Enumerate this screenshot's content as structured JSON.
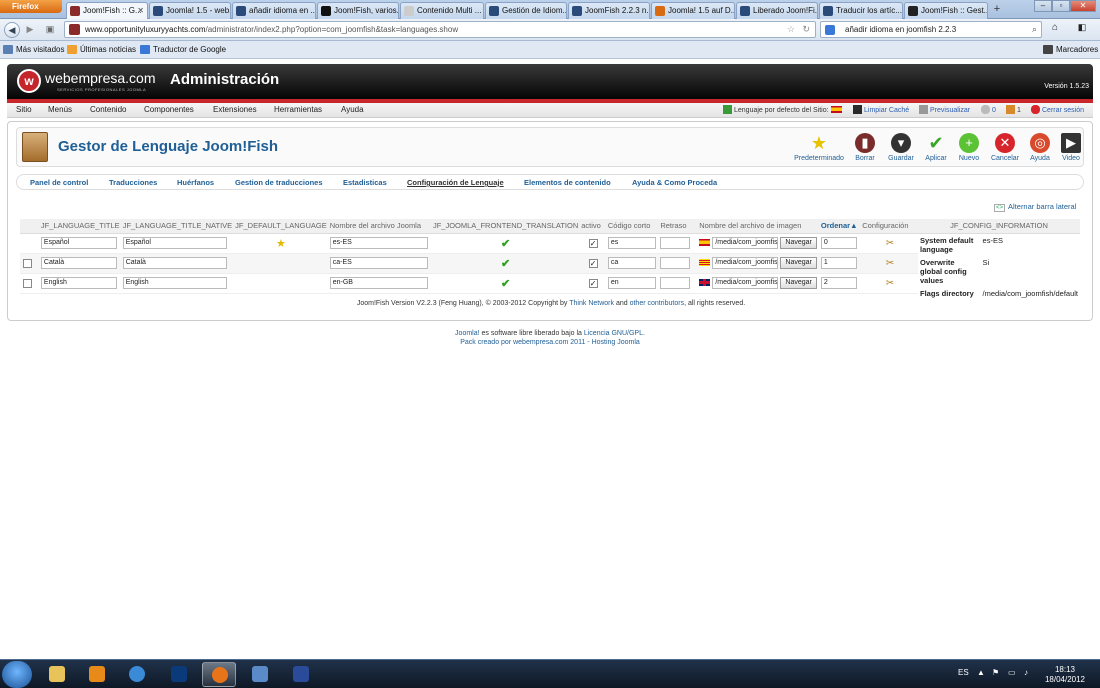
{
  "browser": {
    "app_button": "Firefox",
    "tabs": [
      {
        "label": "Joom!Fish :: G..."
      },
      {
        "label": "Joomla! 1.5 - web..."
      },
      {
        "label": "añadir idioma en ..."
      },
      {
        "label": "Joom!Fish, varios..."
      },
      {
        "label": "Contenido Multi ..."
      },
      {
        "label": "Gestión de Idiom..."
      },
      {
        "label": "JoomFish 2.2.3 n..."
      },
      {
        "label": "Joomla! 1.5 auf D..."
      },
      {
        "label": "Liberado Joom!Fi..."
      },
      {
        "label": "Traducir los artíc..."
      },
      {
        "label": "Joom!Fish :: Gest..."
      }
    ],
    "new_tab": "+",
    "url_host": "www.opportunityluxuryyachts.com",
    "url_path": "/administrator/index2.php?option=com_joomfish&task=languages.show",
    "search_value": "añadir idioma en joomfish 2.2.3",
    "bookmarks": [
      "Más visitados",
      "Últimas noticias",
      "Traductor de Google"
    ],
    "bookmarks_menu": "Marcadores"
  },
  "header": {
    "brand": "webempresa.com",
    "brand_sub": "SERVICIOS PROFESIONALES JOOMLA",
    "title": "Administración",
    "version": "Versión 1.5.23"
  },
  "menu": {
    "items": [
      "Sitio",
      "Menús",
      "Contenido",
      "Componentes",
      "Extensiones",
      "Herramientas",
      "Ayuda"
    ],
    "default_lang": "Lenguaje por defecto del Sitio:",
    "clear_cache": "Limpiar Caché",
    "preview": "Previsualizar",
    "messages": "0",
    "users": "1",
    "logout": "Cerrar sesión"
  },
  "toolbar": {
    "title": "Gestor de Lenguaje Joom!Fish",
    "buttons": [
      {
        "label": "Predeterminado",
        "icon": "star-icon",
        "color": "#e6c200"
      },
      {
        "label": "Borrar",
        "icon": "trash-icon",
        "color": "#7a2b2b"
      },
      {
        "label": "Guardar",
        "icon": "save-icon",
        "color": "#333333"
      },
      {
        "label": "Aplicar",
        "icon": "check-icon",
        "color": "#3aa52a"
      },
      {
        "label": "Nuevo",
        "icon": "plus-icon",
        "color": "#5bc236"
      },
      {
        "label": "Cancelar",
        "icon": "cancel-icon",
        "color": "#d6262c"
      },
      {
        "label": "Ayuda",
        "icon": "help-icon",
        "color": "#d94a2c"
      },
      {
        "label": "Video",
        "icon": "video-icon",
        "color": "#333333"
      }
    ]
  },
  "subnav": [
    "Panel de control",
    "Traducciones",
    "Huérfanos",
    "Gestion de traducciones",
    "Estadisticas",
    "Configuración de Lenguaje",
    "Elementos de contenido",
    "Ayuda & Como Proceda"
  ],
  "toggle_label": "Alternar barra lateral",
  "toggle_icon_text": "<>",
  "table": {
    "headers": [
      "JF_LANGUAGE_TITLE",
      "JF_LANGUAGE_TITLE_NATIVE",
      "JF_DEFAULT_LANGUAGE",
      "Nombre del archivo Joomla",
      "JF_JOOMLA_FRONTEND_TRANSLATION",
      "activo",
      "Código corto",
      "Retraso",
      "Nombre del archivo de imagen",
      "Ordenar",
      "Configuración"
    ],
    "rows": [
      {
        "title": "Español",
        "native": "Español",
        "file": "es-ES",
        "code": "es",
        "image": "/media/com_joomfish/...",
        "order": "0"
      },
      {
        "title": "Català",
        "native": "Català",
        "file": "ca-ES",
        "code": "ca",
        "image": "/media/com_joomfish/...",
        "order": "1"
      },
      {
        "title": "English",
        "native": "English",
        "file": "en-GB",
        "code": "en",
        "image": "/media/com_joomfish/...",
        "order": "2"
      }
    ],
    "browse_label": "Navegar"
  },
  "config": {
    "header": "JF_CONFIG_INFORMATION",
    "rows": [
      {
        "key": "System default language",
        "value": "es-ES"
      },
      {
        "key": "Overwrite global config values",
        "value": "Si"
      },
      {
        "key": "Flags directory",
        "value": "/media/com_joomfish/default"
      }
    ]
  },
  "copyright": {
    "pre": "Joom!Fish Version V2.2.3 (Feng Huang), © 2003-2012 Copyright by",
    "link1": "Think Network",
    "mid": "and",
    "link2": "other contributors",
    "post": ", all rights reserved."
  },
  "footer": {
    "joomla": "Joomla!",
    "line1": "es software libre liberado bajo la",
    "license": "Licencia GNU/GPL.",
    "line2": "Pack creado por webempresa.com 2011 - Hosting Joomla"
  },
  "taskbar": {
    "lang": "ES",
    "time": "18:13",
    "date": "18/04/2012"
  }
}
